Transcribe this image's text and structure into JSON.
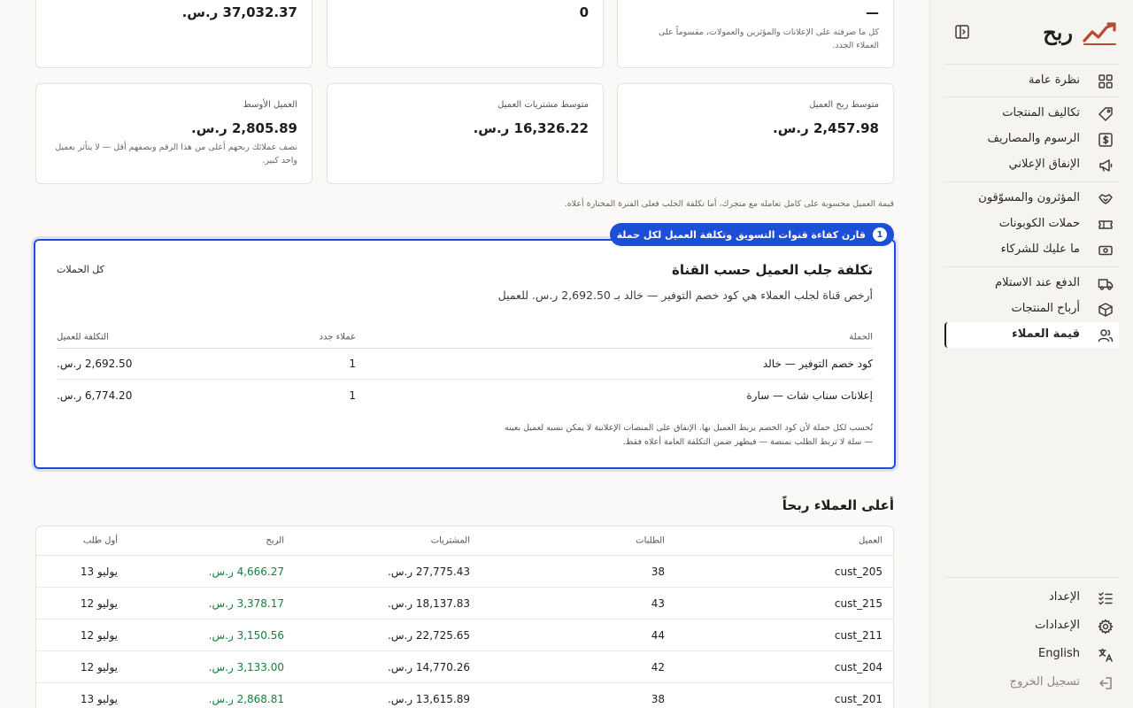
{
  "brand": {
    "name": "ربح",
    "accent": "#b84a2e"
  },
  "nav": {
    "group1": [
      {
        "label": "نظرة عامة",
        "icon": "grid-icon"
      }
    ],
    "group2": [
      {
        "label": "تكاليف المنتجات",
        "icon": "tag-icon"
      },
      {
        "label": "الرسوم والمصاريف",
        "icon": "dollar-icon"
      },
      {
        "label": "الإنفاق الإعلاني",
        "icon": "megaphone-icon"
      }
    ],
    "group3": [
      {
        "label": "المؤثرون والمسوّقون",
        "icon": "handshake-icon"
      },
      {
        "label": "حملات الكوبونات",
        "icon": "ticket-icon"
      },
      {
        "label": "ما عليك للشركاء",
        "icon": "cash-icon"
      }
    ],
    "group4": [
      {
        "label": "الدفع عند الاستلام",
        "icon": "truck-icon"
      },
      {
        "label": "أرباح المنتجات",
        "icon": "box-icon"
      },
      {
        "label": "قيمة العملاء",
        "icon": "users-icon"
      }
    ],
    "bottom": [
      {
        "label": "الإعداد",
        "icon": "checklist-icon"
      },
      {
        "label": "الإعدادات",
        "icon": "gear-icon"
      },
      {
        "label": "English",
        "icon": "translate-icon"
      },
      {
        "label": "تسجيل الخروج",
        "icon": "logout-icon"
      }
    ]
  },
  "kpis_top": [
    {
      "value": "—",
      "note": "كل ما صرفته على الإعلانات والمؤثرين والعمولات، مقسوماً على العملاء الجدد."
    },
    {
      "value": "0"
    },
    {
      "value": "37,032.37 ر.س."
    }
  ],
  "kpis": [
    {
      "label": "متوسط ربح العميل",
      "value": "2,457.98 ر.س."
    },
    {
      "label": "متوسط مشتريات العميل",
      "value": "16,326.22 ر.س."
    },
    {
      "label": "العميل الأوسط",
      "value": "2,805.89 ر.س.",
      "note": "نصف عملائك ربحهم أعلى من هذا الرقم ونصفهم أقل — لا يتأثر بعميل واحد كبير."
    }
  ],
  "footnote": "قيمة العميل محسوبة على كامل تعامله مع متجرك، أما تكلفة الجلب فعلى الفترة المختارة أعلاه.",
  "tour": {
    "step": "1",
    "label": "قارن كفاءة قنوات التسويق وتكلفة العميل لكل حملة"
  },
  "cac": {
    "title": "تكلفة جلب العميل حسب القناة",
    "subtitle": "أرخص قناة لجلب العملاء هي كود خصم التوفير — خالد بـ 2,692.50 ر.س. للعميل",
    "filter": "كل الحملات",
    "headers": {
      "campaign": "الحملة",
      "new_customers": "عملاء جدد",
      "cost": "التكلفة للعميل"
    },
    "rows": [
      {
        "campaign": "كود خصم التوفير — خالد",
        "new_customers": "1",
        "cost": "2,692.50 ر.س."
      },
      {
        "campaign": "إعلانات سناب شات — سارة",
        "new_customers": "1",
        "cost": "6,774.20 ر.س."
      }
    ],
    "note1": "تُحسب لكل حملة لأن كود الخصم يربط العميل بها. الإنفاق على المنصات الإعلانية لا يمكن نسبه لعميل بعينه",
    "note2": "— سلة لا تربط الطلب بمنصة — فيظهر ضمن التكلفة العامة أعلاه فقط."
  },
  "top": {
    "title": "أعلى العملاء ربحاً",
    "headers": {
      "customer": "العميل",
      "orders": "الطلبات",
      "purchases": "المشتريات",
      "profit": "الربح",
      "first_order": "أول طلب"
    },
    "rows": [
      {
        "customer": "cust_205",
        "orders": "38",
        "purchases": "27,775.43 ر.س.",
        "profit": "4,666.27 ر.س.",
        "first_order": "يوليو 13"
      },
      {
        "customer": "cust_215",
        "orders": "43",
        "purchases": "18,137.83 ر.س.",
        "profit": "3,378.17 ر.س.",
        "first_order": "يوليو 12"
      },
      {
        "customer": "cust_211",
        "orders": "44",
        "purchases": "22,725.65 ر.س.",
        "profit": "3,150.56 ر.س.",
        "first_order": "يوليو 12"
      },
      {
        "customer": "cust_204",
        "orders": "42",
        "purchases": "14,770.26 ر.س.",
        "profit": "3,133.00 ر.س.",
        "first_order": "يوليو 12"
      },
      {
        "customer": "cust_201",
        "orders": "38",
        "purchases": "13,615.89 ر.س.",
        "profit": "2,868.81 ر.س.",
        "first_order": "يوليو 13"
      }
    ]
  }
}
